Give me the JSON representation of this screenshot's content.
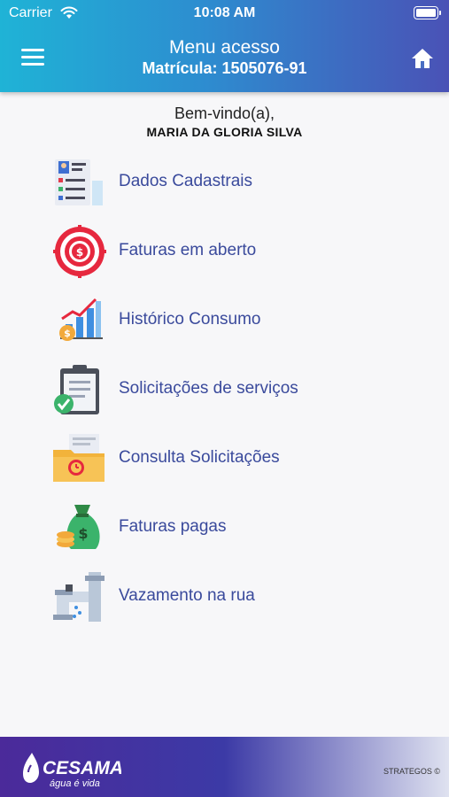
{
  "status_bar": {
    "carrier": "Carrier",
    "time": "10:08 AM"
  },
  "header": {
    "title": "Menu acesso",
    "subtitle": "Matrícula: 1505076-91"
  },
  "greeting": {
    "welcome": "Bem-vindo(a),",
    "name": "MARIA DA GLORIA SILVA"
  },
  "menu": [
    {
      "label": "Dados Cadastrais",
      "icon": "profile-card-icon"
    },
    {
      "label": "Faturas em aberto",
      "icon": "dollar-target-icon"
    },
    {
      "label": "Histórico Consumo",
      "icon": "bar-chart-icon"
    },
    {
      "label": "Solicitações de serviços",
      "icon": "clipboard-check-icon"
    },
    {
      "label": "Consulta Solicitações",
      "icon": "folder-clock-icon"
    },
    {
      "label": "Faturas pagas",
      "icon": "money-bag-icon"
    },
    {
      "label": "Vazamento na rua",
      "icon": "pipe-leak-icon"
    }
  ],
  "footer": {
    "logo_text": "CESAMA",
    "logo_tagline": "água é vida",
    "credit": "STRATEGOS ©"
  },
  "colors": {
    "header_start": "#1fb3d6",
    "header_end": "#4a52b6",
    "label": "#3a4a9c",
    "footer": "#4b2a9a"
  }
}
